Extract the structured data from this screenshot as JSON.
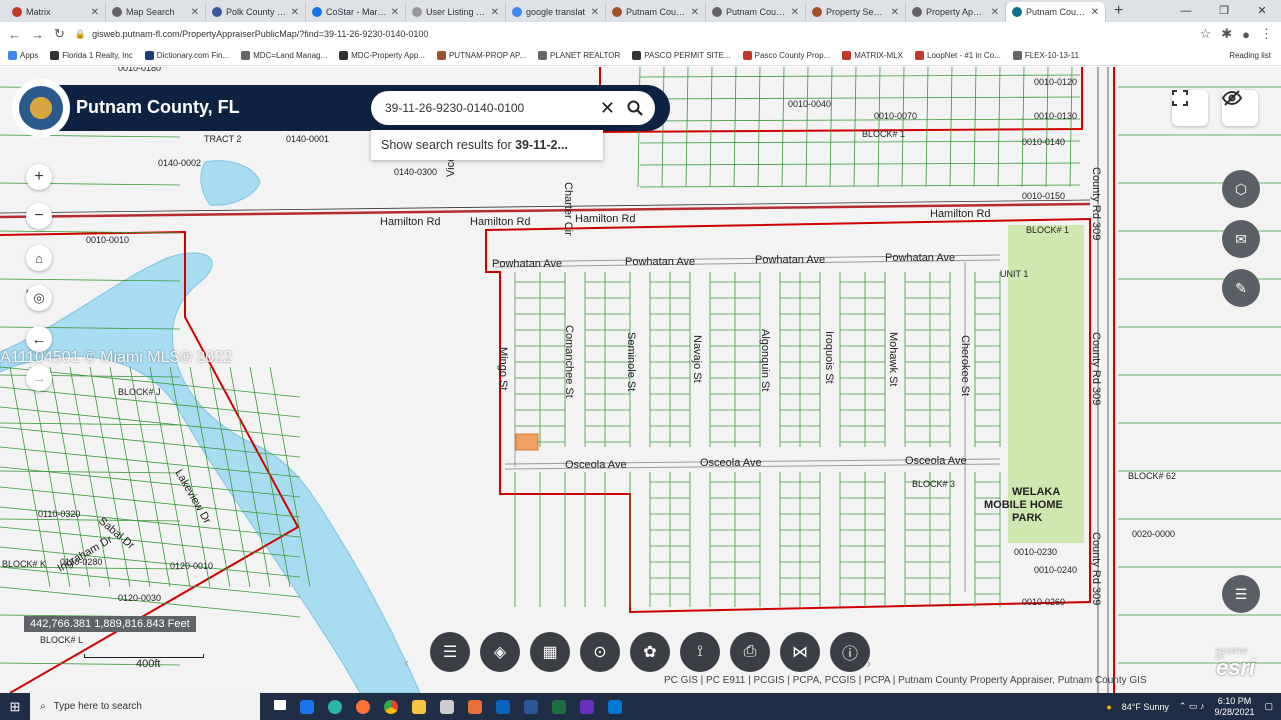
{
  "browser": {
    "tabs": [
      {
        "title": "Matrix",
        "color": "#c0392b"
      },
      {
        "title": "Map Search",
        "color": "#666666"
      },
      {
        "title": "Polk County Pro",
        "color": "#3b5998"
      },
      {
        "title": "CoStar - Market",
        "color": "#1a73e8"
      },
      {
        "title": "User Listing - To",
        "color": "#999999"
      },
      {
        "title": "google translat",
        "color": "#4285f4"
      },
      {
        "title": "Putnam County",
        "color": "#a0522d"
      },
      {
        "title": "Putnam County",
        "color": "#666666"
      },
      {
        "title": "Property Search",
        "color": "#a0522d"
      },
      {
        "title": "Property Apprai",
        "color": "#666666"
      },
      {
        "title": "Putnam County",
        "color": "#0b6e8a",
        "active": true
      }
    ],
    "new_tab": "+",
    "url": "gisweb.putnam-fl.com/PropertyAppraiserPublicMap/?find=39-11-26-9230-0140-0100",
    "bookmarks": [
      {
        "label": "Apps",
        "color": "#4285f4"
      },
      {
        "label": "Florida 1 Realty, Inc",
        "color": "#333333"
      },
      {
        "label": "Dictionary.com  Fin...",
        "color": "#1a3d7a"
      },
      {
        "label": "MDC=Land Manag...",
        "color": "#666666"
      },
      {
        "label": "MDC-Property App...",
        "color": "#333333"
      },
      {
        "label": "PUTNAM-PROP AP...",
        "color": "#a0522d"
      },
      {
        "label": "PLANET REALTOR",
        "color": "#666666"
      },
      {
        "label": "PASCO PERMIT SITE...",
        "color": "#333333"
      },
      {
        "label": "Pasco County Prop...",
        "color": "#c0392b"
      },
      {
        "label": "MATRIX-MLX",
        "color": "#c0392b"
      },
      {
        "label": "LoopNet - #1 in Co...",
        "color": "#c0392b"
      },
      {
        "label": "FLEX-10-13-11",
        "color": "#666666"
      }
    ],
    "reading_list": "Reading list"
  },
  "map_app": {
    "title": "Putnam County, FL",
    "search_value": "39-11-26-9230-0140-0100",
    "search_results_prefix": "Show search results for ",
    "search_results_bold": "39-11-2...",
    "coordinates": "442,766.381 1,889,816.843 Feet",
    "scale_label": "400ft",
    "watermark": "A11104501 © Miami MLS® 2022",
    "attribution": "PC GIS | PC E911 | PCGIS | PCPA, PCGIS | PCPA | Putnam County Property Appraiser, Putnam County GIS",
    "esri_label": "esri",
    "esri_powered": "POWERED BY"
  },
  "map_labels": {
    "streets": [
      {
        "text": "Hamilton Rd"
      },
      {
        "text": "Hamilton Rd"
      },
      {
        "text": "Hamilton Rd"
      },
      {
        "text": "Hamilton Rd"
      },
      {
        "text": "Powhatan Ave"
      },
      {
        "text": "Powhatan Ave"
      },
      {
        "text": "Powhatan Ave"
      },
      {
        "text": "Powhatan Ave"
      },
      {
        "text": "Osceola Ave"
      },
      {
        "text": "Osceola Ave"
      },
      {
        "text": "Osceola Ave"
      },
      {
        "text": "County Rd 309"
      },
      {
        "text": "County Rd 309"
      },
      {
        "text": "County Rd 309"
      },
      {
        "text": "Mingo St"
      },
      {
        "text": "Comanchee St"
      },
      {
        "text": "Seminole St"
      },
      {
        "text": "Navajo St"
      },
      {
        "text": "Algonquin St"
      },
      {
        "text": "Iroquois St"
      },
      {
        "text": "Mohawk St"
      },
      {
        "text": "Cherokee St"
      },
      {
        "text": "Lakeview Dr"
      },
      {
        "text": "Sabal Dr"
      },
      {
        "text": "Ingraham Dr"
      },
      {
        "text": "Viceroy Dr"
      },
      {
        "text": "Charter Cir"
      }
    ],
    "parcels": [
      {
        "text": "0010-0010"
      },
      {
        "text": "0140-0001"
      },
      {
        "text": "0140-0002"
      },
      {
        "text": "0140-0300"
      },
      {
        "text": "0010-0040"
      },
      {
        "text": "0010-0070"
      },
      {
        "text": "0010-0120"
      },
      {
        "text": "0010-0130"
      },
      {
        "text": "0010-0140"
      },
      {
        "text": "0010-0150"
      },
      {
        "text": "0010-0230"
      },
      {
        "text": "0010-0240"
      },
      {
        "text": "0010-0260"
      },
      {
        "text": "0020-0000"
      },
      {
        "text": "0110-0320"
      },
      {
        "text": "0110-0280"
      },
      {
        "text": "0120-0010"
      },
      {
        "text": "0120-0030"
      },
      {
        "text": "0010-0180"
      }
    ],
    "blocks": [
      {
        "text": "BLOCK# 1"
      },
      {
        "text": "BLOCK# 1"
      },
      {
        "text": "BLOCK# J"
      },
      {
        "text": "BLOCK# K"
      },
      {
        "text": "BLOCK# L"
      },
      {
        "text": "BLOCK# 62"
      },
      {
        "text": "BLOCK# 3"
      },
      {
        "text": "K# A"
      },
      {
        "text": "TRACT 2"
      },
      {
        "text": "UNIT 1"
      }
    ],
    "park": [
      "WELAKA",
      "MOBILE HOME",
      "PARK"
    ]
  },
  "toolbar": {
    "buttons": [
      "list-icon",
      "layers-icon",
      "grid-icon",
      "locate-icon",
      "palette-icon",
      "measure-icon",
      "print-icon",
      "share-icon",
      "info-icon"
    ]
  },
  "taskbar": {
    "search_placeholder": "Type here to search",
    "weather": "84°F  Sunny",
    "time": "6:10 PM",
    "date": "9/28/2021"
  },
  "colors": {
    "header": "#0d2240",
    "boundary": "#d00000",
    "parcel_line": "#3a9a3a",
    "lot_number": "#9b1fb4",
    "water": "#a8dcf0",
    "park": "#cfe8b0"
  }
}
